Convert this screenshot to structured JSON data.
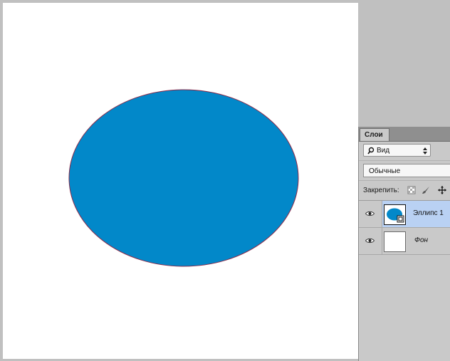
{
  "canvas": {
    "background": "#ffffff",
    "shape": {
      "type": "ellipse",
      "fill": "#0288c9",
      "stroke": "#8a2a4a"
    }
  },
  "layers_panel": {
    "tab_label": "Слои",
    "filter": {
      "icon": "search-icon",
      "value": "Вид"
    },
    "blend_mode": "Обычные",
    "lock_label": "Закрепить:",
    "lock_icons": [
      "lock-transparent-pixels-icon",
      "lock-image-pixels-icon",
      "lock-position-icon"
    ],
    "layers": [
      {
        "name": "Эллипс 1",
        "visible": true,
        "selected": true,
        "kind": "shape"
      },
      {
        "name": "Фон",
        "visible": true,
        "selected": false,
        "kind": "background"
      }
    ],
    "selection_color": "#b9d1f3"
  }
}
